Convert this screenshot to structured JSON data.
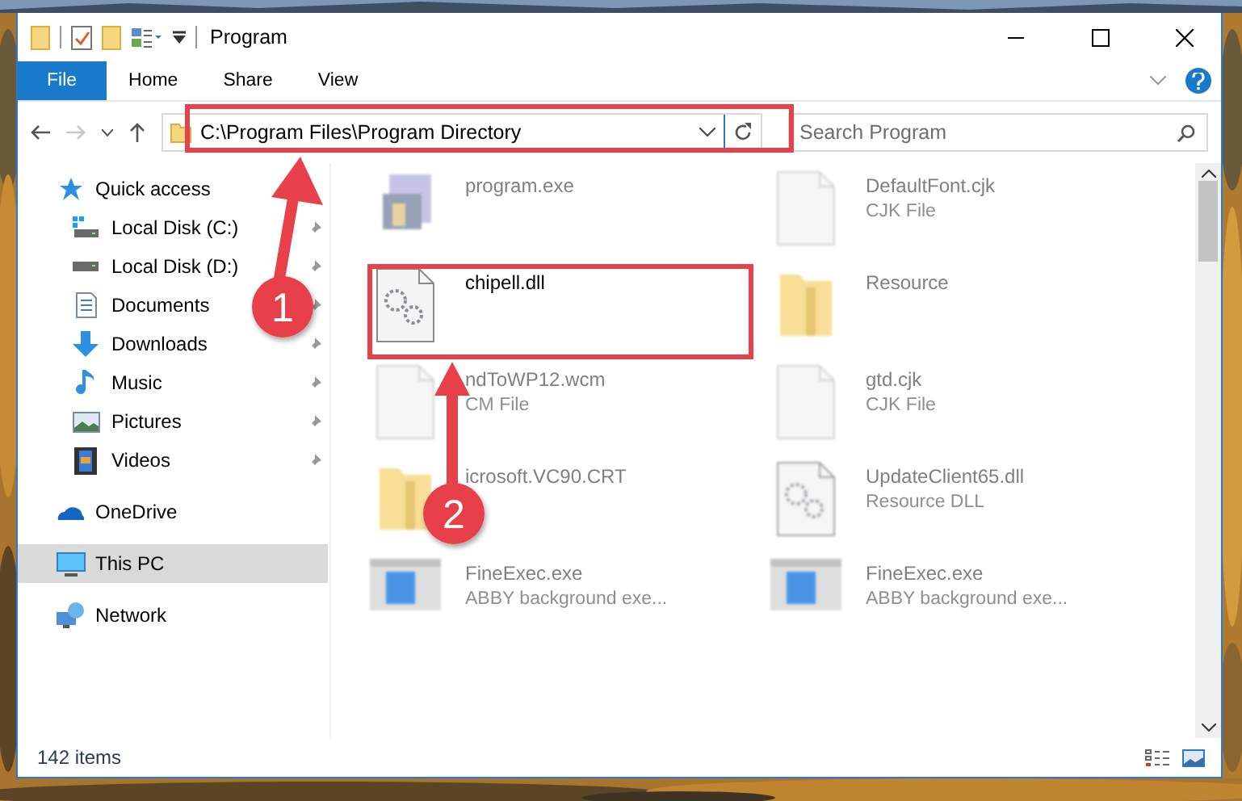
{
  "window": {
    "title": "Program"
  },
  "ribbon": {
    "tabs": [
      {
        "label": "File",
        "kind": "file",
        "selected": false
      },
      {
        "label": "Home",
        "kind": "tab",
        "selected": false
      },
      {
        "label": "Share",
        "kind": "tab",
        "selected": false
      },
      {
        "label": "View",
        "kind": "tab",
        "selected": false
      }
    ]
  },
  "address": {
    "path": "C:\\Program Files\\Program Directory"
  },
  "search": {
    "placeholder": "Search Program"
  },
  "navigation": [
    {
      "label": "Quick access",
      "kind": "star",
      "selected": false,
      "children": [
        {
          "label": "Local Disk (C:)",
          "kind": "drive-c",
          "pinned": true,
          "selected": false
        },
        {
          "label": "Local Disk (D:)",
          "kind": "drive",
          "pinned": true,
          "selected": false
        },
        {
          "label": "Documents",
          "kind": "docs",
          "pinned": true,
          "selected": false
        },
        {
          "label": "Downloads",
          "kind": "download",
          "pinned": true,
          "selected": false
        },
        {
          "label": "Music",
          "kind": "music",
          "pinned": true,
          "selected": false
        },
        {
          "label": "Pictures",
          "kind": "pictures",
          "pinned": true,
          "selected": false
        },
        {
          "label": "Videos",
          "kind": "videos",
          "pinned": true,
          "selected": false
        }
      ]
    },
    {
      "label": "OneDrive",
      "kind": "cloud",
      "selected": false
    },
    {
      "label": "This PC",
      "kind": "pc",
      "selected": true
    },
    {
      "label": "Network",
      "kind": "network",
      "selected": false
    }
  ],
  "files": [
    {
      "name": "program.exe",
      "kind": "exe",
      "blurred": true
    },
    {
      "name": "DefaultFont.cjk",
      "type": "CJK File",
      "kind": "doc",
      "blurred": true
    },
    {
      "name": "chipell.dll",
      "kind": "dll",
      "blurred": false
    },
    {
      "name": "Resource",
      "kind": "folder",
      "blurred": true
    },
    {
      "name": "ndToWP12.wcm",
      "type": "CM File",
      "kind": "doc",
      "blurred": true
    },
    {
      "name": "gtd.cjk",
      "type": "CJK File",
      "kind": "doc",
      "blurred": true
    },
    {
      "name": "icrosoft.VC90.CRT",
      "kind": "folder",
      "blurred": true
    },
    {
      "name": "UpdateClient65.dll",
      "type": "Resource DLL",
      "kind": "dll",
      "blurred": true
    },
    {
      "name": "FineExec.exe",
      "type": "ABBY background exe...",
      "kind": "app",
      "blurred": true
    },
    {
      "name": "FineExec.exe",
      "type": "ABBY background exe...",
      "kind": "app",
      "blurred": true
    }
  ],
  "status_bar": {
    "count": "142 items"
  },
  "annotations": [
    {
      "number": "1"
    },
    {
      "number": "2"
    }
  ]
}
